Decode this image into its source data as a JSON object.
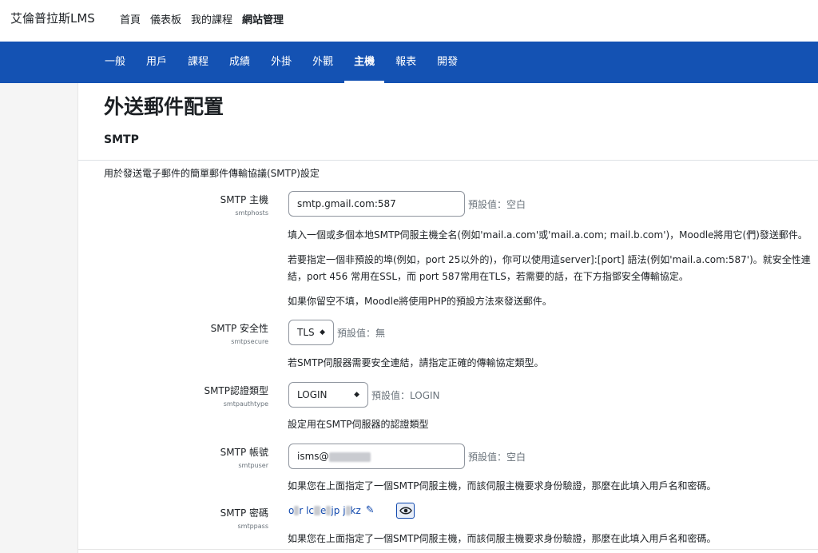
{
  "header": {
    "brand": "艾倫普拉斯LMS",
    "nav": [
      "首頁",
      "儀表板",
      "我的課程",
      "網站管理"
    ]
  },
  "secondary_nav": {
    "tabs": [
      "一般",
      "用戶",
      "課程",
      "成績",
      "外掛",
      "外觀",
      "主機",
      "報表",
      "開發"
    ],
    "active": "主機"
  },
  "page": {
    "title": "外送郵件配置",
    "section_title": "SMTP",
    "section_desc": "用於發送電子郵件的簡單郵件傳輸協議(SMTP)設定"
  },
  "settings": {
    "smtphosts": {
      "label": "SMTP 主機",
      "key": "smtphosts",
      "value": "smtp.gmail.com:587",
      "default": "預設值：空白",
      "desc1": "填入一個或多個本地SMTP伺服主機全名(例如'mail.a.com'或'mail.a.com; mail.b.com')，Moodle將用它(們)發送郵件。",
      "desc2": "若要指定一個非預設的埠(例如，port 25以外的)，你可以使用這server]:[port] 語法(例如'mail.a.com:587')。就安全性連結，port 456 常用在SSL，而 port 587常用在TLS，若需要的話，在下方指鄧安全傳輸協定。",
      "desc3": "如果你留空不填，Moodle將使用PHP的預設方法來發送郵件。"
    },
    "smtpsecure": {
      "label": "SMTP 安全性",
      "key": "smtpsecure",
      "value": "TLS",
      "default": "預設值：無",
      "desc": "若SMTP伺服器需要安全連結，請指定正確的傳輸協定類型。"
    },
    "smtpauthtype": {
      "label": "SMTP認證類型",
      "key": "smtpauthtype",
      "value": "LOGIN",
      "default": "預設值：LOGIN",
      "desc": "設定用在SMTP伺服器的認證類型"
    },
    "smtpuser": {
      "label": "SMTP 帳號",
      "key": "smtpuser",
      "value": "isms@",
      "default": "預設值：空白",
      "desc": "如果您在上面指定了一個SMTP伺服主機，而該伺服主機要求身份驗證，那麼在此填入用戶名和密碼。"
    },
    "smtppass": {
      "label": "SMTP 密碼",
      "key": "smtppass",
      "value_parts": [
        "o",
        "r lc",
        " e",
        "jp j",
        "kz"
      ],
      "desc": "如果您在上面指定了一個SMTP伺服主機，而該伺服主機要求身份驗證，那麼在此填入用戶名和密碼。"
    }
  }
}
